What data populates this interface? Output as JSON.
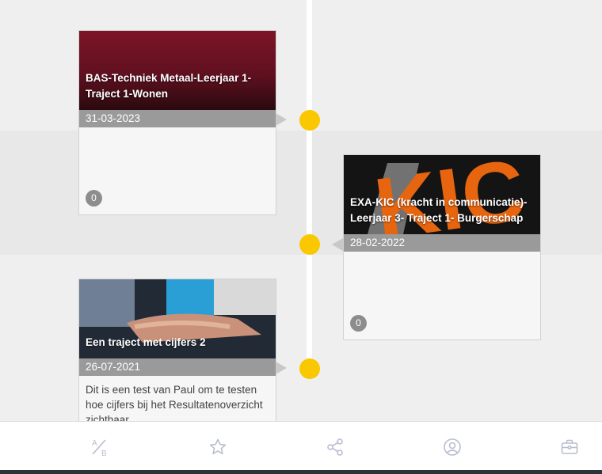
{
  "timeline": {
    "items": [
      {
        "title": "BAS-Techniek Metaal-Leerjaar 1- Traject 1-Wonen",
        "date": "31-03-2023",
        "description": "",
        "count": "0"
      },
      {
        "title": "EXA-KIC (kracht in communicatie)- Leerjaar 3- Traject 1- Burgerschap",
        "date": "28-02-2022",
        "description": "",
        "count": "0",
        "image_text": "KIC"
      },
      {
        "title": "Een traject met cijfers 2",
        "date": "26-07-2021",
        "description": "Dit is een test van Paul om te testen hoe cijfers bij het Resultatenoverzicht zichtbaar",
        "count": ""
      }
    ]
  },
  "colors": {
    "dot": "#f9c800",
    "date_bar": "#9a9a9a",
    "badge": "#8d8d8d",
    "icon": "#b9bdd0"
  },
  "tabbar": {
    "tabs": [
      {
        "icon": "ab-icon",
        "glyph_top": "A",
        "glyph_bottom": "B"
      },
      {
        "icon": "star-icon"
      },
      {
        "icon": "share-icon"
      },
      {
        "icon": "user-circle-icon"
      },
      {
        "icon": "briefcase-icon"
      }
    ]
  }
}
